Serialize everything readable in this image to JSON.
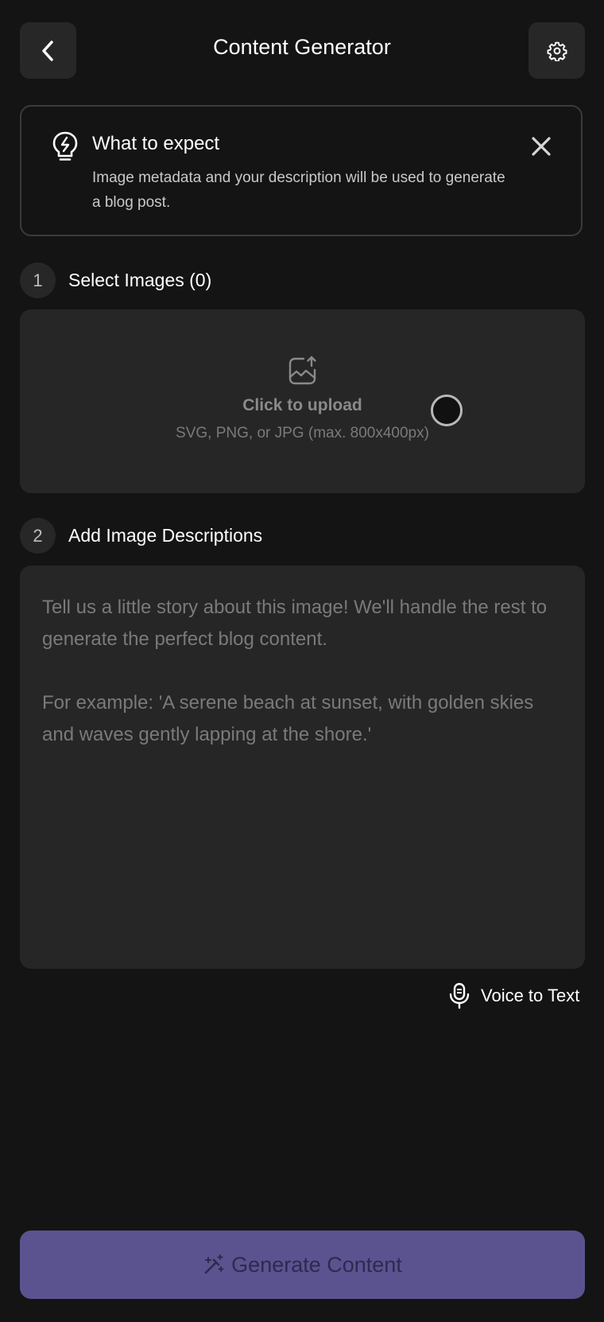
{
  "header": {
    "title": "Content Generator",
    "back_icon": "chevron-left-icon",
    "settings_icon": "gear-icon"
  },
  "info": {
    "title": "What to expect",
    "body": "Image metadata and your description will be used to generate a blog post.",
    "icon": "lightbulb-bolt-icon",
    "close_icon": "close-icon"
  },
  "steps": [
    {
      "number": "1",
      "label": "Select Images (0)"
    },
    {
      "number": "2",
      "label": "Add Image Descriptions"
    }
  ],
  "upload": {
    "title": "Click to upload",
    "hint": "SVG, PNG, or JPG (max. 800x400px)",
    "icon": "image-upload-icon"
  },
  "description": {
    "value": "",
    "placeholder": "Tell us a little story about this image! We'll handle the rest to generate the perfect blog content.\n\nFor example: 'A serene beach at sunset, with golden skies and waves gently lapping at the shore.'"
  },
  "voice": {
    "label": "Voice to Text",
    "icon": "microphone-icon"
  },
  "generate": {
    "label": "Generate Content",
    "icon": "magic-wand-icon"
  },
  "colors": {
    "background": "#141414",
    "surface": "#262626",
    "button_surface": "#272727",
    "accent": "#5a5390",
    "accent_text": "#2e2a4e",
    "muted_text": "#7a7a7a"
  }
}
